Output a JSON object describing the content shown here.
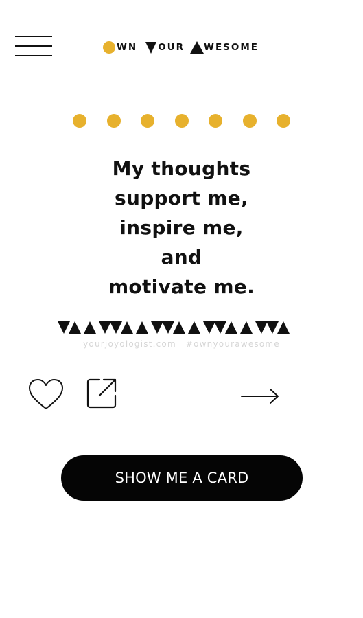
{
  "header": {
    "logo_parts": [
      "WN",
      "OUR",
      "WESOME"
    ],
    "menu_icon": "hamburger-menu-icon"
  },
  "colors": {
    "accent": "#e7b12d",
    "text": "#111111",
    "button_bg": "#050505",
    "button_text": "#ffffff",
    "muted_text": "#d6d6d6"
  },
  "progress": {
    "dot_count": 7
  },
  "card": {
    "lines": [
      "My thoughts",
      "support me,",
      "inspire me,",
      "and",
      "motivate me."
    ]
  },
  "footer": {
    "site": "yourjoyologist.com",
    "hashtag": "#ownyourawesome"
  },
  "actions": {
    "favorite_icon": "heart-icon",
    "share_icon": "share-icon",
    "next_icon": "arrow-right-icon"
  },
  "cta": {
    "label": "SHOW ME A CARD"
  }
}
